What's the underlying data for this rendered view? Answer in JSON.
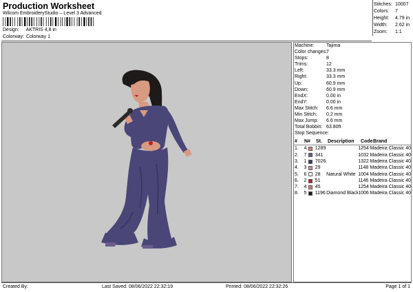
{
  "header": {
    "title": "Production Worksheet",
    "software": "Wilcom EmbroideryStudio – Level 3 Advanced",
    "design_label": "Design:",
    "design_value": "AKTRIS 4,8 in",
    "colorway_label": "Colorway:",
    "colorway_value": "Colorway 1"
  },
  "top_stats": [
    {
      "label": "Stitches:",
      "value": "10007"
    },
    {
      "label": "Colors:",
      "value": "7"
    },
    {
      "label": "Height:",
      "value": "4.79 in"
    },
    {
      "label": "Width:",
      "value": "2.62 in"
    },
    {
      "label": "Zoom:",
      "value": "1:1"
    }
  ],
  "machine_info": [
    {
      "label": "Machine:",
      "value": "Tajima"
    },
    {
      "label": "Color changes:",
      "value": "7"
    },
    {
      "label": "Stops:",
      "value": "8"
    },
    {
      "label": "Trims:",
      "value": "12"
    },
    {
      "label": "Left:",
      "value": "33.3 mm"
    },
    {
      "label": "Right:",
      "value": "33.3 mm"
    },
    {
      "label": "Up:",
      "value": "60.9 mm"
    },
    {
      "label": "Down:",
      "value": "60.9 mm"
    },
    {
      "label": "EndX:",
      "value": "0.00 in"
    },
    {
      "label": "EndY:",
      "value": "0.00 in"
    },
    {
      "label": "Max Stitch:",
      "value": "6.6 mm"
    },
    {
      "label": "Min Stitch:",
      "value": "0.2 mm"
    },
    {
      "label": "Max Jump:",
      "value": "6.6 mm"
    },
    {
      "label": "Total Bobbin:",
      "value": "63.80ft"
    }
  ],
  "stop_sequence": {
    "title": "Stop Sequence:",
    "headers": {
      "num": "#",
      "n": "N#",
      "st": "St.",
      "desc": "Description",
      "code": "Code",
      "brand": "Brand"
    },
    "rows": [
      {
        "num": "1.",
        "n": "4",
        "color": "#d4846c",
        "st": "1289",
        "desc": "",
        "code": "1254",
        "brand": "Madeira Classic 40"
      },
      {
        "num": "2.",
        "n": "7",
        "color": "#6c5d8e",
        "st": "341",
        "desc": "",
        "code": "1032",
        "brand": "Madeira Classic 40"
      },
      {
        "num": "3.",
        "n": "1",
        "color": "#3c3c68",
        "st": "7026",
        "desc": "",
        "code": "1322",
        "brand": "Madeira Classic 40"
      },
      {
        "num": "4.",
        "n": "3",
        "color": "#d88aa6",
        "st": "29",
        "desc": "",
        "code": "1148",
        "brand": "Madeira Classic 40"
      },
      {
        "num": "5.",
        "n": "6",
        "color": "#ffffff",
        "st": "28",
        "desc": "Natural White",
        "code": "1004",
        "brand": "Madeira Classic 40"
      },
      {
        "num": "6.",
        "n": "2",
        "color": "#c41e2a",
        "st": "51",
        "desc": "",
        "code": "1146",
        "brand": "Madeira Classic 40"
      },
      {
        "num": "7.",
        "n": "4",
        "color": "#d4846c",
        "st": "45",
        "desc": "",
        "code": "1254",
        "brand": "Madeira Classic 40"
      },
      {
        "num": "8.",
        "n": "5",
        "color": "#1a1a1a",
        "st": "1196",
        "desc": "Diamond Black",
        "code": "1006",
        "brand": "Madeira Classic 40"
      }
    ]
  },
  "footer": {
    "created_by": "Created By:",
    "last_saved": "Last Saved: 08/06/2022 22:32:19",
    "printed": "Printed: 08/06/2022 22:32:26",
    "page": "Page 1 of 1"
  },
  "design_colors": {
    "suit": "#4a4677",
    "suit_dark": "#35325a",
    "hair": "#1e1a1a",
    "skin": "#d89a80",
    "mic": "#2a2a2a"
  }
}
